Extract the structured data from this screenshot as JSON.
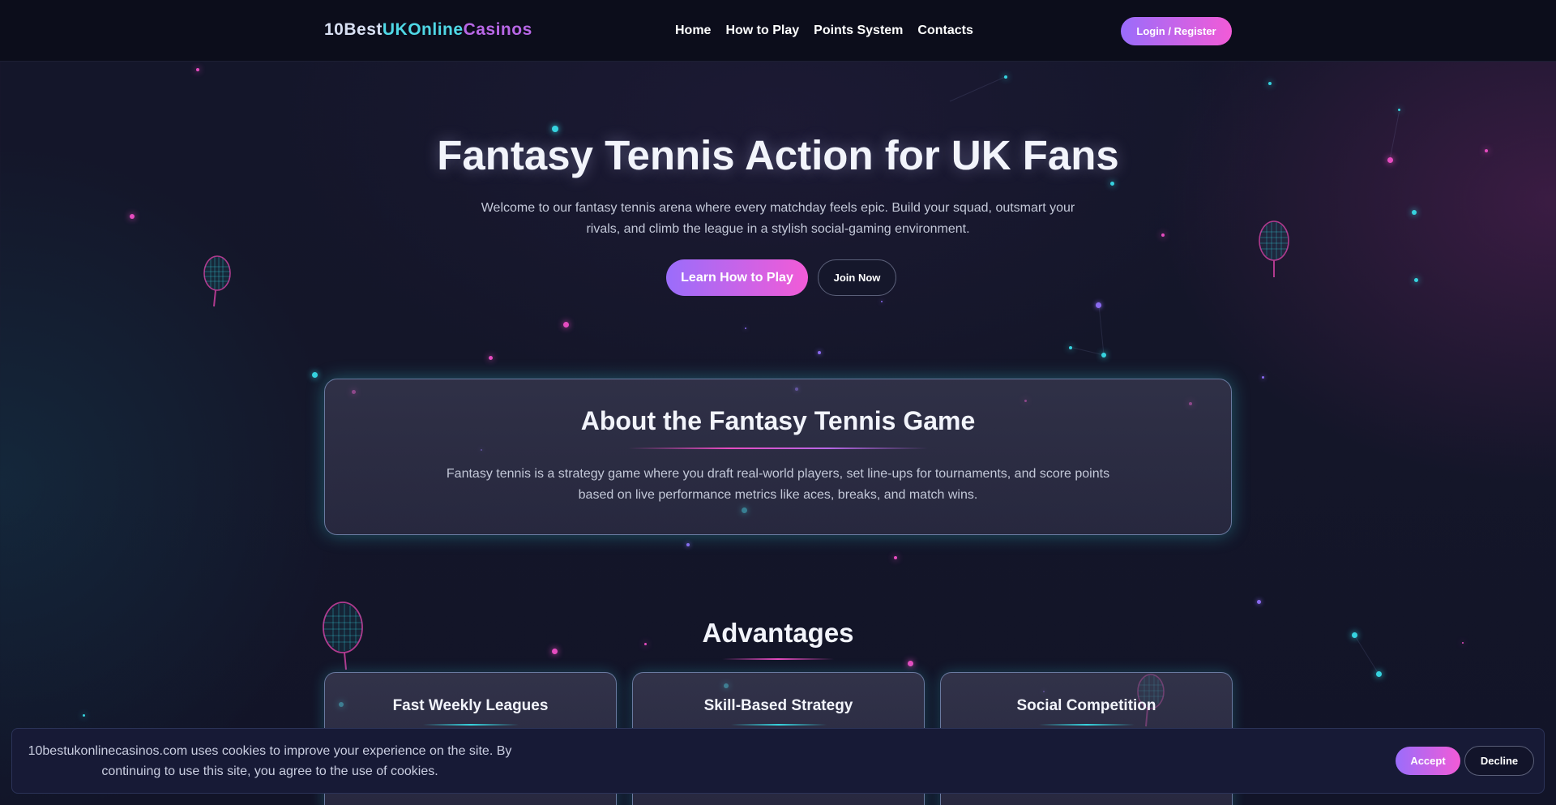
{
  "header": {
    "logo": {
      "part1": "10Best",
      "part2": "UKOnline",
      "part3": "Casinos"
    },
    "nav": [
      "Home",
      "How to Play",
      "Points System",
      "Contacts"
    ],
    "login_label": "Login / Register"
  },
  "hero": {
    "title": "Fantasy Tennis Action for UK Fans",
    "subtitle": "Welcome to our fantasy tennis arena where every matchday feels epic. Build your squad, outsmart your rivals, and climb the league in a stylish social-gaming environment.",
    "primary_cta": "Learn How to Play",
    "secondary_cta": "Join Now"
  },
  "about": {
    "title": "About the Fantasy Tennis Game",
    "text": "Fantasy tennis is a strategy game where you draft real-world players, set line-ups for tournaments, and score points based on live performance metrics like aces, breaks, and match wins."
  },
  "advantages": {
    "title": "Advantages",
    "cards": [
      "Fast Weekly Leagues",
      "Skill-Based Strategy",
      "Social Competition"
    ]
  },
  "cookie": {
    "text": "10bestukonlinecasinos.com uses cookies to improve your experience on the site. By continuing to use this site, you agree to the use of cookies.",
    "accept": "Accept",
    "decline": "Decline"
  },
  "colors": {
    "accent_gradient_start": "#9a6dfb",
    "accent_gradient_end": "#f25bd7",
    "cyan": "#36d3df",
    "magenta": "#e64cc0",
    "background": "#141629"
  },
  "icons": [
    "tennis-racket-icon"
  ]
}
